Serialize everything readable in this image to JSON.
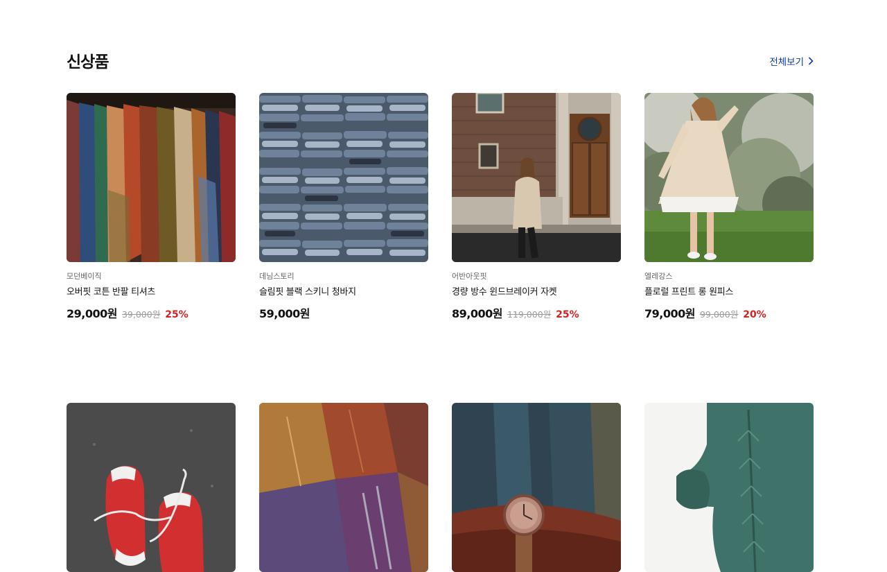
{
  "section": {
    "title": "신상품",
    "view_all": "전체보기"
  },
  "products": [
    {
      "brand": "모던베이직",
      "name": "오버핏 코튼 반팔 티셔츠",
      "price": "29,000원",
      "original_price": "39,000원",
      "discount": "25%",
      "image": "colorful-shirts-on-rack"
    },
    {
      "brand": "데님스토리",
      "name": "슬림핏 블랙 스키니 청바지",
      "price": "59,000원",
      "original_price": "",
      "discount": "",
      "image": "stacked-folded-jeans"
    },
    {
      "brand": "어반아웃핏",
      "name": "경량 방수 윈드브레이커 자켓",
      "price": "89,000원",
      "original_price": "119,000원",
      "discount": "25%",
      "image": "woman-walking-brick-building"
    },
    {
      "brand": "엘레강스",
      "name": "플로럴 프린트 롱 원피스",
      "price": "79,000원",
      "original_price": "99,000원",
      "discount": "20%",
      "image": "woman-in-dress-garden"
    },
    {
      "brand": "",
      "name": "",
      "price": "",
      "original_price": "",
      "discount": "",
      "image": "red-sneakers-on-asphalt"
    },
    {
      "brand": "",
      "name": "",
      "price": "",
      "original_price": "",
      "discount": "",
      "image": "leather-jackets-pile"
    },
    {
      "brand": "",
      "name": "",
      "price": "",
      "original_price": "",
      "discount": "",
      "image": "wristwatch-on-fabric"
    },
    {
      "brand": "",
      "name": "",
      "price": "",
      "original_price": "",
      "discount": "",
      "image": "green-knit-sweater"
    }
  ],
  "colors": {
    "accent_link": "#0b3b9e",
    "discount": "#d3201f",
    "muted": "#999999"
  }
}
